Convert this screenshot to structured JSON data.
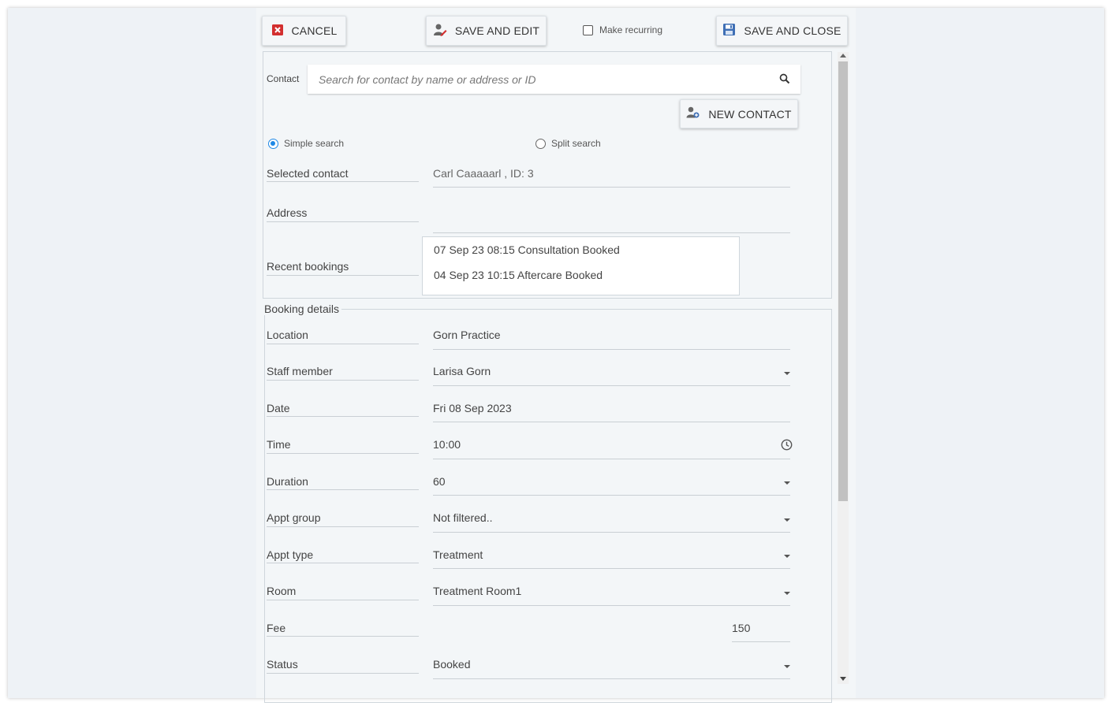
{
  "toolbar": {
    "cancel_label": "CANCEL",
    "save_edit_label": "SAVE AND EDIT",
    "recurring_label": "Make recurring",
    "save_close_label": "SAVE AND CLOSE"
  },
  "contact": {
    "label": "Contact",
    "search_placeholder": "Search for contact by name or address or ID",
    "new_contact_label": "NEW CONTACT",
    "simple_search_label": "Simple search",
    "split_search_label": "Split search",
    "selected_contact_label": "Selected contact",
    "selected_contact_value": "Carl Caaaaarl , ID: 3",
    "address_label": "Address",
    "address_value": "",
    "recent_bookings_label": "Recent bookings",
    "recent_bookings": [
      "07 Sep 23 08:15 Consultation Booked",
      "04 Sep 23 10:15 Aftercare Booked"
    ]
  },
  "booking": {
    "legend": "Booking details",
    "fields": [
      {
        "label": "Location",
        "value": "Gorn Practice"
      },
      {
        "label": "Staff member",
        "value": "Larisa Gorn"
      },
      {
        "label": "Date",
        "value": "Fri 08 Sep 2023"
      },
      {
        "label": "Time",
        "value": "10:00"
      },
      {
        "label": "Duration",
        "value": "60"
      },
      {
        "label": "Appt group",
        "value": "Not filtered.."
      },
      {
        "label": "Appt type",
        "value": "Treatment"
      },
      {
        "label": "Room",
        "value": "Treatment Room1"
      },
      {
        "label": "Fee",
        "value": "150"
      },
      {
        "label": "Status",
        "value": "Booked"
      }
    ]
  },
  "icons": {
    "cancel": "cancel-x-icon",
    "save_edit": "user-edit-icon",
    "save_close": "floppy-disk-icon",
    "search": "search-icon",
    "new_contact": "user-add-icon",
    "time": "clock-icon",
    "dropdown": "caret-down-icon"
  },
  "colors": {
    "cancel_icon": "#d32f2f",
    "save_icon": "#3f6fb5",
    "radio_selected": "#1e88e5"
  }
}
